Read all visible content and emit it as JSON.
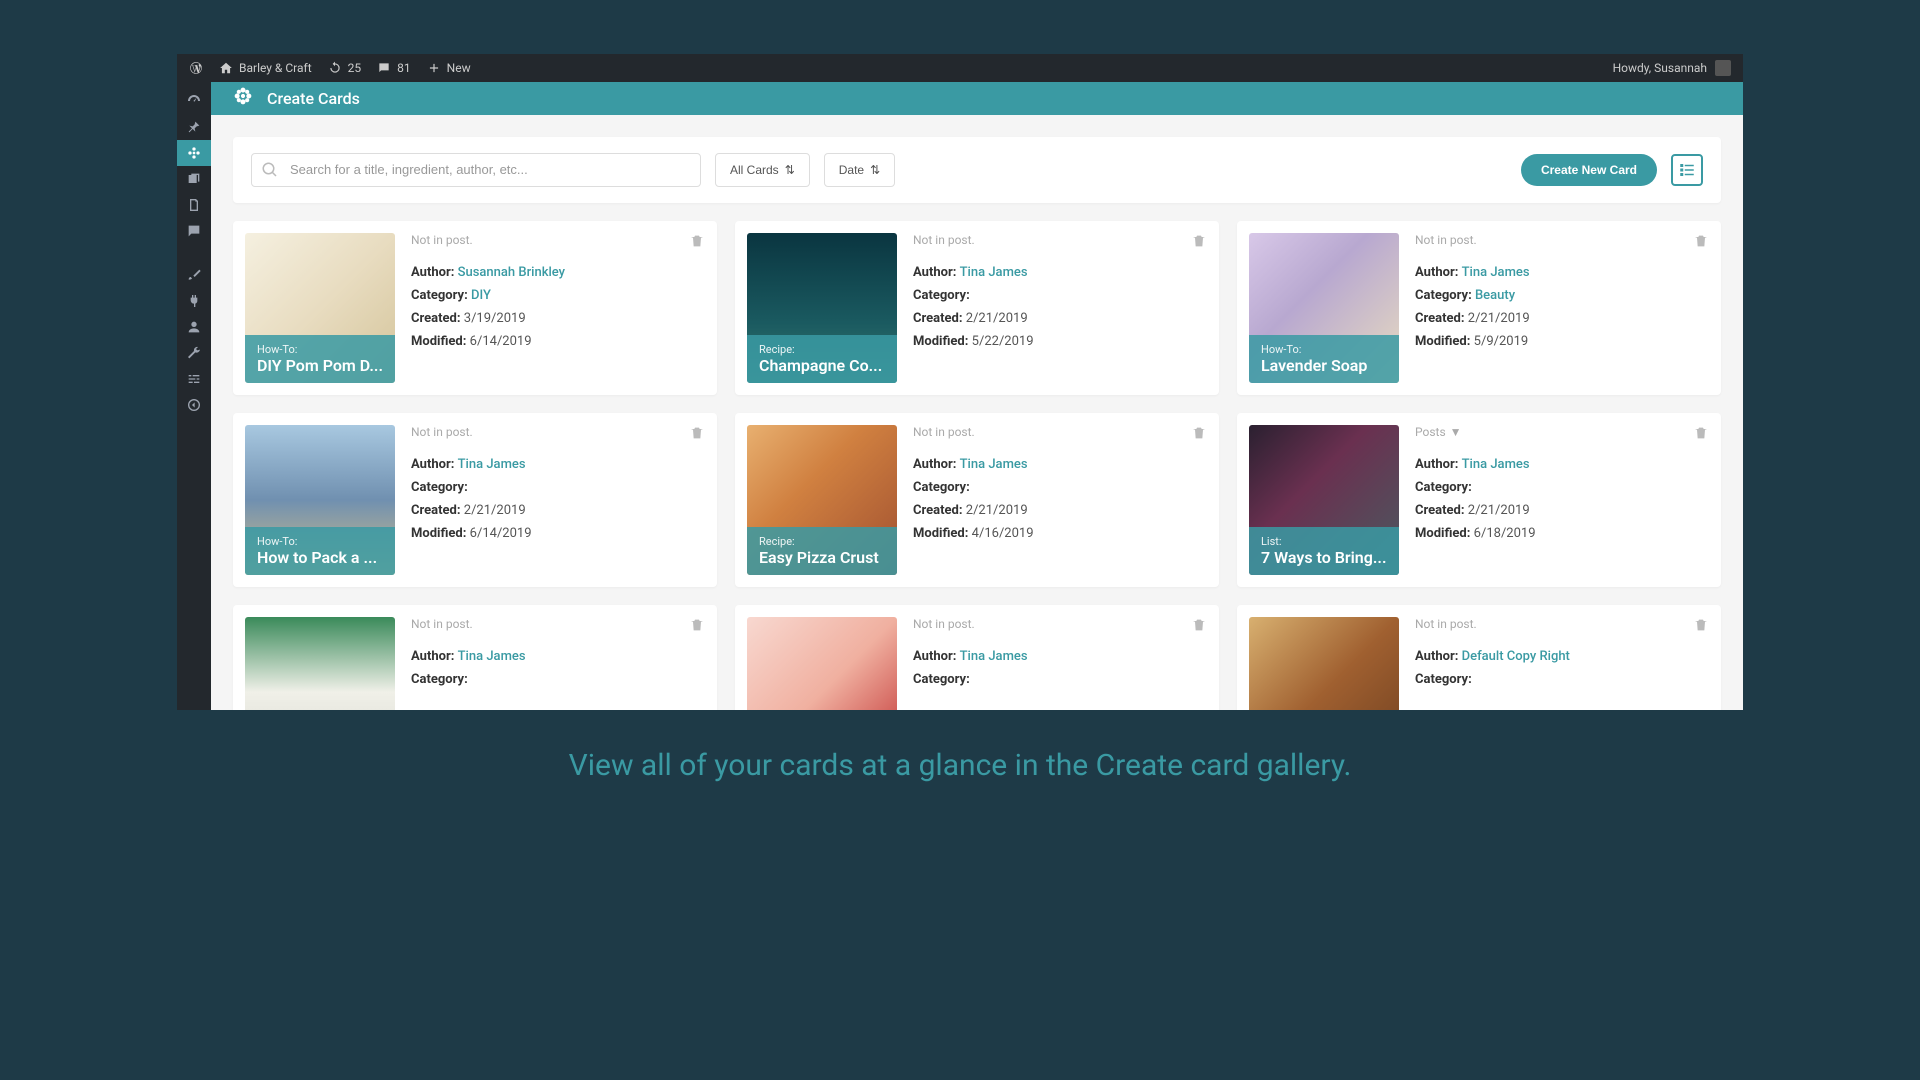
{
  "adminbar": {
    "site_name": "Barley & Craft",
    "refresh_count": "25",
    "comments_count": "81",
    "new_label": "New",
    "greeting": "Howdy, Susannah"
  },
  "header": {
    "title": "Create Cards"
  },
  "toolbar": {
    "search_placeholder": "Search for a title, ingredient, author, etc...",
    "filter_all": "All Cards",
    "filter_date": "Date",
    "create_label": "Create New Card"
  },
  "labels": {
    "author": "Author:",
    "category": "Category:",
    "created": "Created:",
    "modified": "Modified:",
    "not_in_post": "Not in post.",
    "posts": "Posts"
  },
  "cards": [
    {
      "type_label": "How-To:",
      "title": "DIY Pom Pom D...",
      "status": "not_in_post",
      "author": "Susannah Brinkley",
      "category": "DIY",
      "created": "3/19/2019",
      "modified": "6/14/2019",
      "thumb": "th-1"
    },
    {
      "type_label": "Recipe:",
      "title": "Champagne Co...",
      "status": "not_in_post",
      "author": "Tina James",
      "category": "",
      "created": "2/21/2019",
      "modified": "5/22/2019",
      "thumb": "th-2"
    },
    {
      "type_label": "How-To:",
      "title": "Lavender Soap",
      "status": "not_in_post",
      "author": "Tina James",
      "category": "Beauty",
      "created": "2/21/2019",
      "modified": "5/9/2019",
      "thumb": "th-3"
    },
    {
      "type_label": "How-To:",
      "title": "How to Pack a ...",
      "status": "not_in_post",
      "author": "Tina James",
      "category": "",
      "created": "2/21/2019",
      "modified": "6/14/2019",
      "thumb": "th-4"
    },
    {
      "type_label": "Recipe:",
      "title": "Easy Pizza Crust",
      "status": "not_in_post",
      "author": "Tina James",
      "category": "",
      "created": "2/21/2019",
      "modified": "4/16/2019",
      "thumb": "th-5"
    },
    {
      "type_label": "List:",
      "title": "7 Ways to Bring...",
      "status": "posts",
      "author": "Tina James",
      "category": "",
      "created": "2/21/2019",
      "modified": "6/18/2019",
      "thumb": "th-6"
    },
    {
      "type_label": "",
      "title": "",
      "status": "not_in_post",
      "author": "Tina James",
      "category": "",
      "created": "",
      "modified": "",
      "thumb": "th-7"
    },
    {
      "type_label": "",
      "title": "",
      "status": "not_in_post",
      "author": "Tina James",
      "category": "",
      "created": "",
      "modified": "",
      "thumb": "th-8"
    },
    {
      "type_label": "",
      "title": "",
      "status": "not_in_post",
      "author": "Default Copy Right",
      "category": "",
      "created": "",
      "modified": "",
      "thumb": "th-9"
    }
  ],
  "caption": "View all of your cards at a glance in the Create card gallery."
}
